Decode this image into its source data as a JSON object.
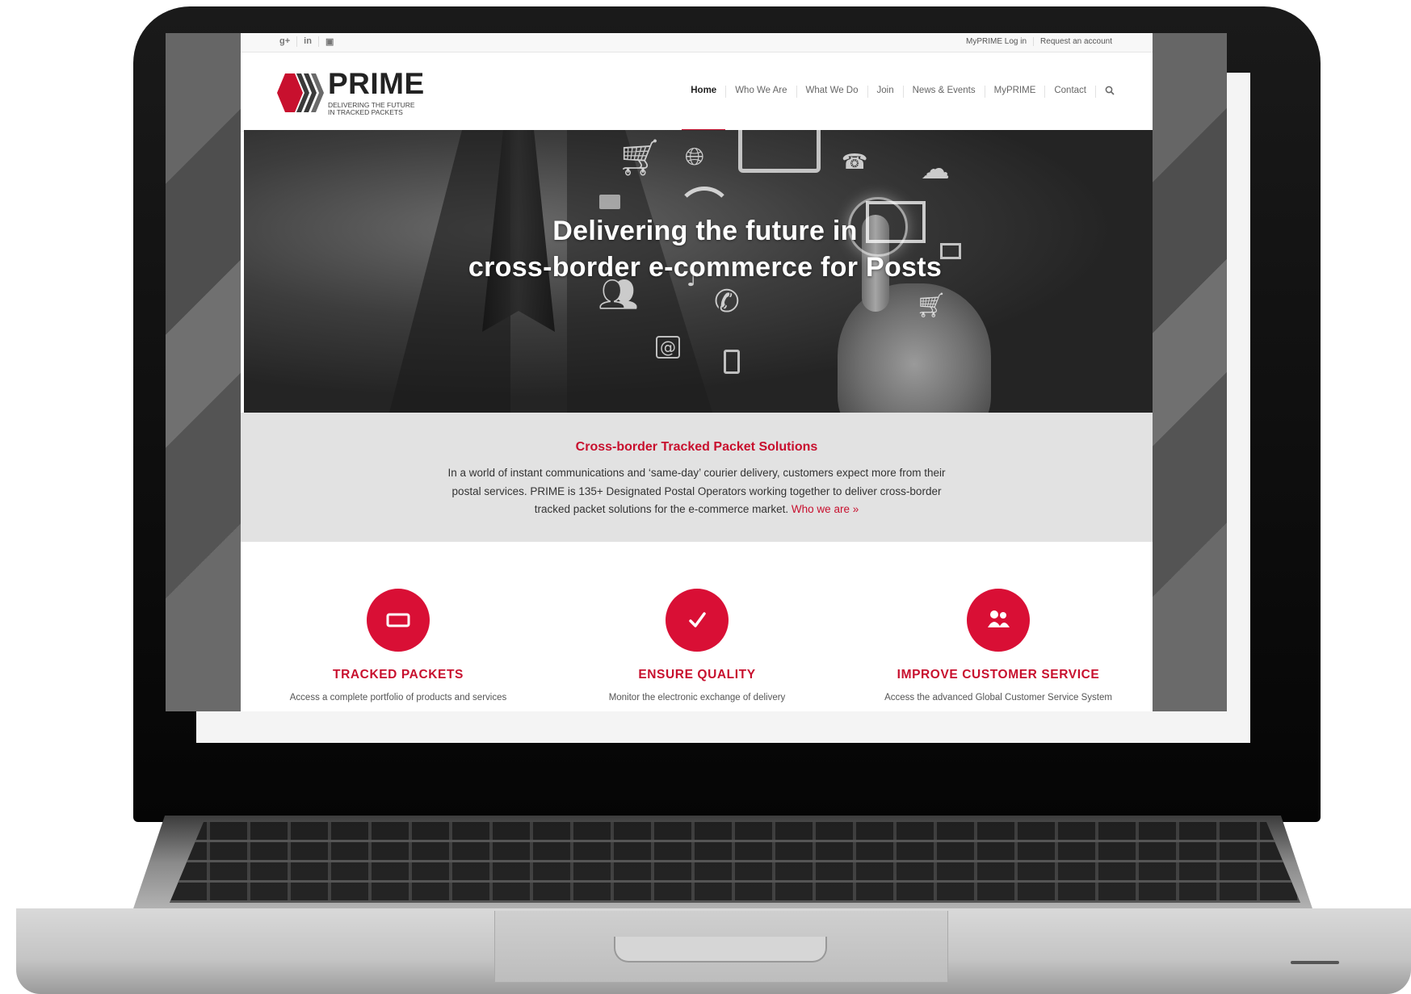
{
  "topbar": {
    "social": [
      "g+",
      "in",
      "▣"
    ],
    "login": "MyPRIME Log in",
    "request": "Request an account"
  },
  "logo": {
    "name": "PRIME",
    "tagline_line1": "DELIVERING THE FUTURE",
    "tagline_line2": "IN TRACKED PACKETS"
  },
  "nav": {
    "items": [
      "Home",
      "Who We Are",
      "What We Do",
      "Join",
      "News & Events",
      "MyPRIME",
      "Contact"
    ],
    "active": "Home"
  },
  "hero": {
    "title_line1": "Delivering the future in",
    "title_line2": "cross-border e-commerce for Posts"
  },
  "intro": {
    "heading": "Cross-border Tracked Packet Solutions",
    "body": "In a world of instant communications and ‘same-day’ courier delivery, customers expect more from their postal services. PRIME is 135+ Designated Postal Operators working together to deliver cross-border tracked packet solutions for the e-commerce market.",
    "link": "Who we are »"
  },
  "features": [
    {
      "title": "TRACKED PACKETS",
      "text": "Access a complete portfolio of products and services",
      "icon": "package-icon"
    },
    {
      "title": "ENSURE QUALITY",
      "text": "Monitor the electronic exchange of delivery",
      "icon": "checkmark-icon"
    },
    {
      "title": "IMPROVE CUSTOMER SERVICE",
      "text": "Access the advanced Global Customer Service System",
      "icon": "users-icon"
    }
  ],
  "colors": {
    "brand_red": "#c8102e",
    "feature_circle": "#d90f35",
    "intro_bg": "#e2e2e2"
  }
}
